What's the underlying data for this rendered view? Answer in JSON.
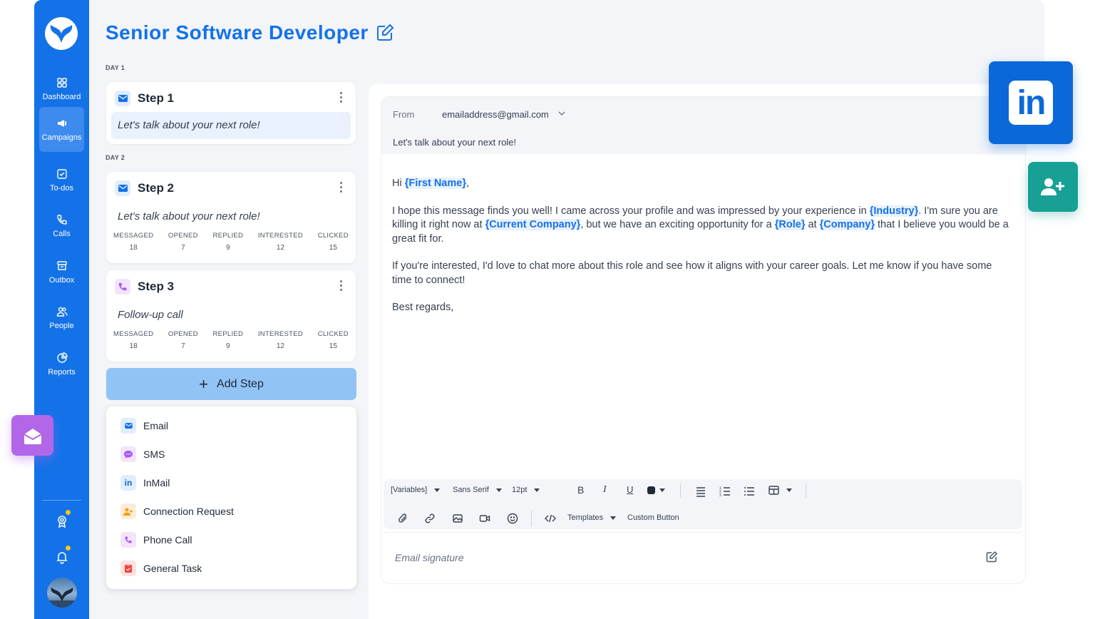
{
  "title": "Senior Software Developer",
  "sidebar": {
    "items": [
      {
        "label": "Dashboard",
        "icon": "dashboard-icon"
      },
      {
        "label": "Campaigns",
        "icon": "megaphone-icon"
      },
      {
        "label": "To-dos",
        "icon": "checkbox-icon"
      },
      {
        "label": "Calls",
        "icon": "phone-icon"
      },
      {
        "label": "Outbox",
        "icon": "archive-icon"
      },
      {
        "label": "People",
        "icon": "people-icon"
      },
      {
        "label": "Reports",
        "icon": "pie-chart-icon"
      }
    ],
    "active": "Campaigns"
  },
  "days": {
    "day1": "DAY 1",
    "day2": "DAY 2"
  },
  "steps": [
    {
      "title": "Step 1",
      "subject": "Let's talk about your next role!",
      "type": "email"
    },
    {
      "title": "Step 2",
      "subject": "Let's talk about your next role!",
      "type": "email",
      "stats": [
        {
          "label": "MESSAGED",
          "value": "18"
        },
        {
          "label": "OPENED",
          "value": "7"
        },
        {
          "label": "REPLIED",
          "value": "9"
        },
        {
          "label": "INTERESTED",
          "value": "12"
        },
        {
          "label": "CLICKED",
          "value": "15"
        }
      ]
    },
    {
      "title": "Step 3",
      "subject": "Follow-up call",
      "type": "phone",
      "stats": [
        {
          "label": "MESSAGED",
          "value": "18"
        },
        {
          "label": "OPENED",
          "value": "7"
        },
        {
          "label": "REPLIED",
          "value": "9"
        },
        {
          "label": "INTERESTED",
          "value": "12"
        },
        {
          "label": "CLICKED",
          "value": "15"
        }
      ]
    }
  ],
  "add_step_label": "Add Step",
  "step_menu": [
    {
      "label": "Email",
      "icon": "email-icon"
    },
    {
      "label": "SMS",
      "icon": "sms-icon"
    },
    {
      "label": "InMail",
      "icon": "linkedin-icon"
    },
    {
      "label": "Connection Request",
      "icon": "connection-icon"
    },
    {
      "label": "Phone Call",
      "icon": "phone-icon"
    },
    {
      "label": "General Task",
      "icon": "task-icon"
    }
  ],
  "email": {
    "from_label": "From",
    "from_value": "emailaddress@gmail.com",
    "subject": "Let's talk about your next role!",
    "greeting": "Hi ",
    "greeting_var": "{First Name}",
    "greeting_end": ",",
    "p1_a": "I hope this message finds you well! I came across your profile and was impressed by your experience in ",
    "p1_var1": "{Industry}",
    "p1_b": ". I'm sure you are killing it right now at ",
    "p1_var2": "{Current Company}",
    "p1_c": ", but we have an exciting opportunity for a ",
    "p1_var3": "{Role}",
    "p1_d": " at ",
    "p1_var4": "{Company}",
    "p1_e": " that I believe you would be a great fit for.",
    "p2": "If you're interested, I'd love to chat more about this role and see how it aligns with your career goals. Let me know if you have some time to connect!",
    "p3": "Best regards,",
    "signature_placeholder": "Email signature"
  },
  "toolbar": {
    "variables": "[Variables]",
    "font": "Sans Serif",
    "size": "12pt",
    "bold": "B",
    "italic": "I",
    "underline": "U",
    "templates": "Templates",
    "custom_button": "Custom Button"
  },
  "colors": {
    "primary": "#1472e8",
    "linkedin": "#0b68d9",
    "connect": "#17a094",
    "inbox": "#b167e8"
  }
}
